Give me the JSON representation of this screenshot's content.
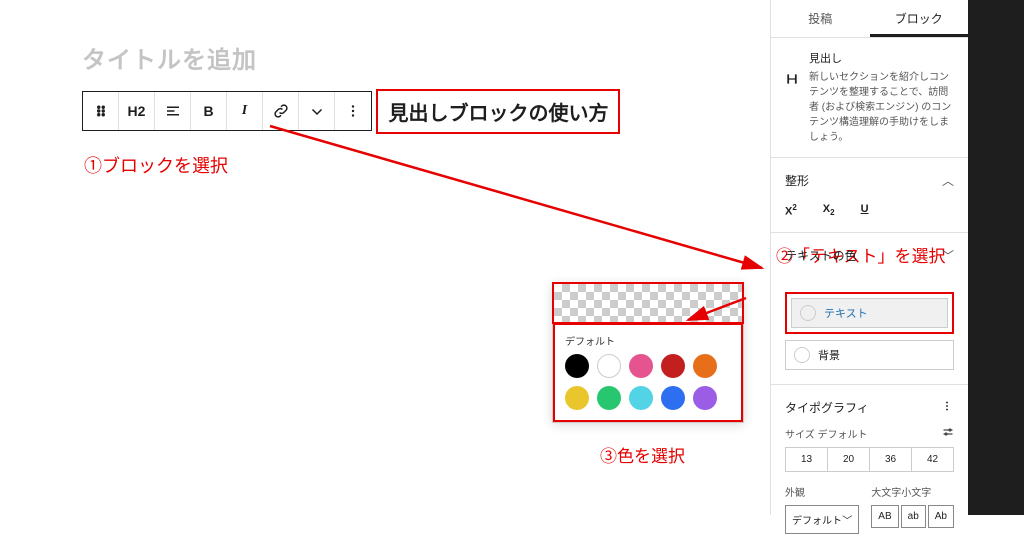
{
  "editor": {
    "title_placeholder": "タイトルを追加",
    "toolbar": {
      "heading_level": "H2",
      "bold": "B",
      "italic": "I"
    },
    "heading_text": "見出しブロックの使い方"
  },
  "callouts": {
    "c1": "①ブロックを選択",
    "c2": "②「テキスト」を選択",
    "c3": "③色を選択"
  },
  "color_popover": {
    "group_label": "デフォルト",
    "swatches": [
      "#000000",
      "#ffffff",
      "#e65490",
      "#c31f1f",
      "#e86f1a",
      "#e9c62c",
      "#28c76f",
      "#52d3e6",
      "#2e6ff2",
      "#9b5de5"
    ]
  },
  "sidebar": {
    "tabs": {
      "post": "投稿",
      "block": "ブロック"
    },
    "block_info": {
      "title": "見出し",
      "desc": "新しいセクションを紹介しコンテンツを整理することで、訪問者 (および検索エンジン) のコンテンツ構造理解の手助けをしましょう。"
    },
    "panels": {
      "format": {
        "label": "整形"
      },
      "text_color": {
        "label": "テキストの色"
      },
      "typography": {
        "label": "タイポグラフィ"
      }
    },
    "color_options": {
      "text": "テキスト",
      "background": "背景"
    },
    "typography": {
      "size_label": "サイズ",
      "size_default": "デフォルト",
      "sizes": [
        "13",
        "20",
        "36",
        "42"
      ],
      "appearance_label": "外観",
      "appearance_value": "デフォルト",
      "caps_label": "大文字小文字",
      "caps": [
        "AB",
        "ab",
        "Ab"
      ]
    }
  }
}
